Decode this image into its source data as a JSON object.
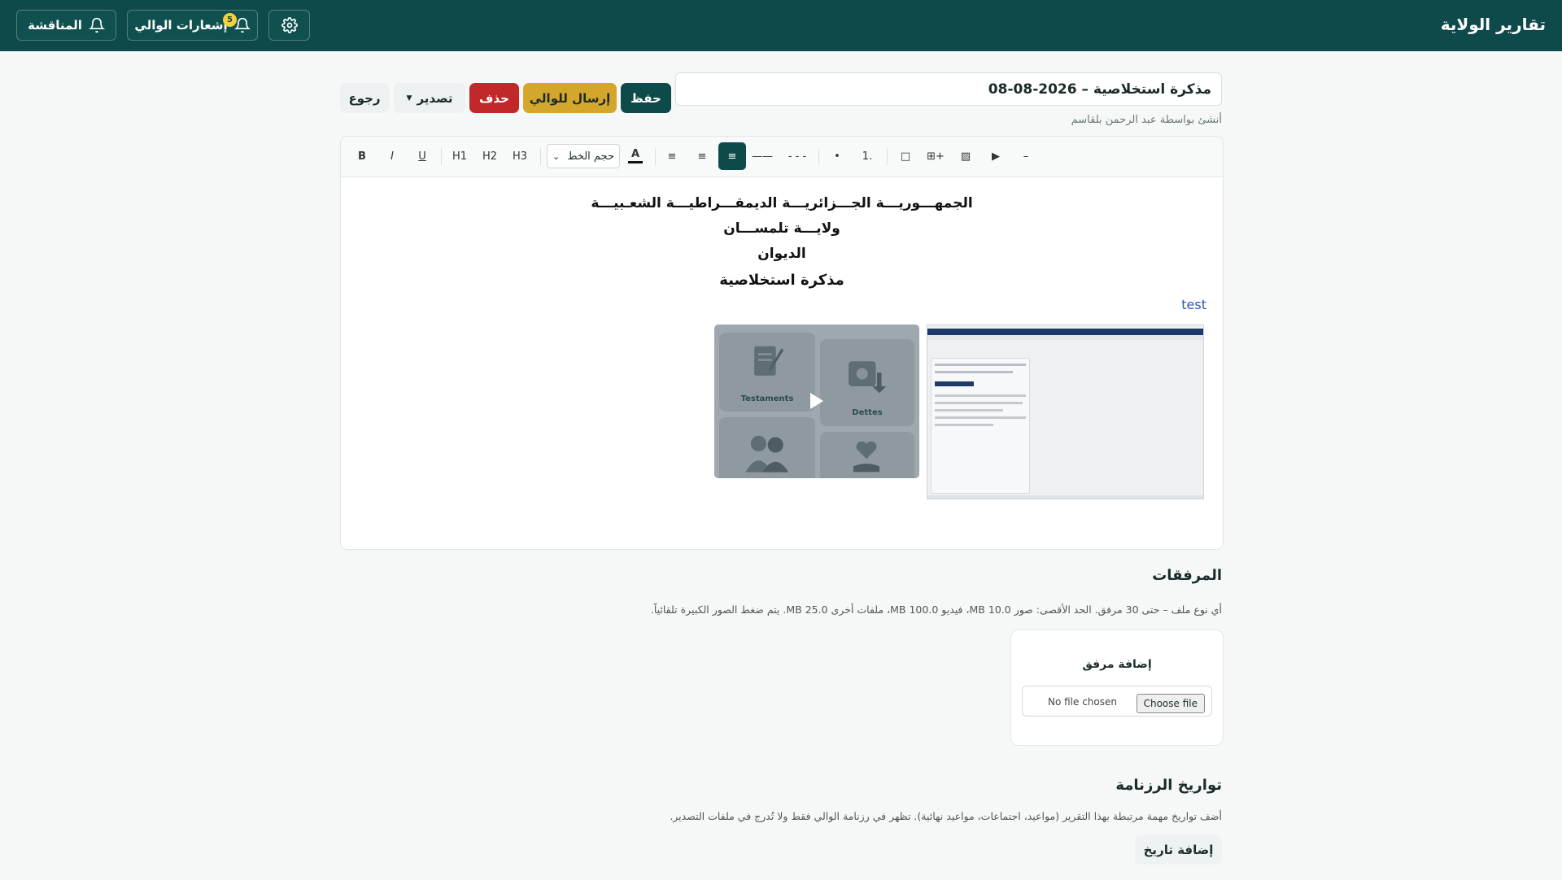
{
  "topbar": {
    "app_title": "تقارير الولاية",
    "governor_notifications_label": "إشعارات الوالي",
    "governor_notifications_count": "5",
    "discussion_label": "المناقشة"
  },
  "document": {
    "title_value": "مذكرة استخلاصية – 2026-08-08",
    "created_by": "أنشئ بواسطة عبد الرحمن بلقاسم"
  },
  "actions": {
    "save": "حفظ",
    "send_to_governor": "إرسال للوالي",
    "delete": "حذف",
    "export": "تصدير",
    "back": "رجوع"
  },
  "toolbar": {
    "bold": "B",
    "italic": "I",
    "underline": "U",
    "h1": "H1",
    "h2": "H2",
    "h3": "H3",
    "font_size": "حجم الخط",
    "text_color": "A",
    "align_left": "≡",
    "align_center": "≡",
    "align_right": "≡",
    "line_short": "——",
    "line_dashed": "- - -",
    "bullet_list": "•",
    "numbered_list": "1.",
    "box": "□",
    "table": "⊞+",
    "image": "▨",
    "video": "▶",
    "hr": "–"
  },
  "editor": {
    "heading_line1": "الجمهـــوريـــة الجـــزائريـــة الديمقـــراطيـــة الشعـبيـــة",
    "heading_line2": "ولايـــة تلمســـان",
    "heading_line3": "الديوان",
    "heading_line4": "مذكرة استخلاصية",
    "test_text": "test",
    "video_tile_1": "Testaments",
    "video_tile_2": "Dettes"
  },
  "attachments": {
    "title": "المرفقات",
    "description": "أي نوع ملف – حتى 30 مرفق. الحد الأقصى: صور 10.0 MB، فيديو 100.0 MB، ملفات أخرى 25.0 MB. يتم ضغط الصور الكبيرة تلقائياً.",
    "add_title": "إضافة مرفق",
    "choose_file": "Choose file",
    "no_file": "No file chosen"
  },
  "calendar": {
    "title": "تواريخ الرزنامة",
    "description": "أضف تواريخ مهمة مرتبطة بهذا التقرير (مواعيد، اجتماعات، مواعيد نهائية). تظهر في رزنامة الوالي فقط ولا تُدرج في ملفات التصدير.",
    "add_date": "إضافة تاريخ"
  },
  "colors": {
    "primary": "#0f4a4a",
    "send": "#d4a72c",
    "delete": "#c0282a"
  }
}
